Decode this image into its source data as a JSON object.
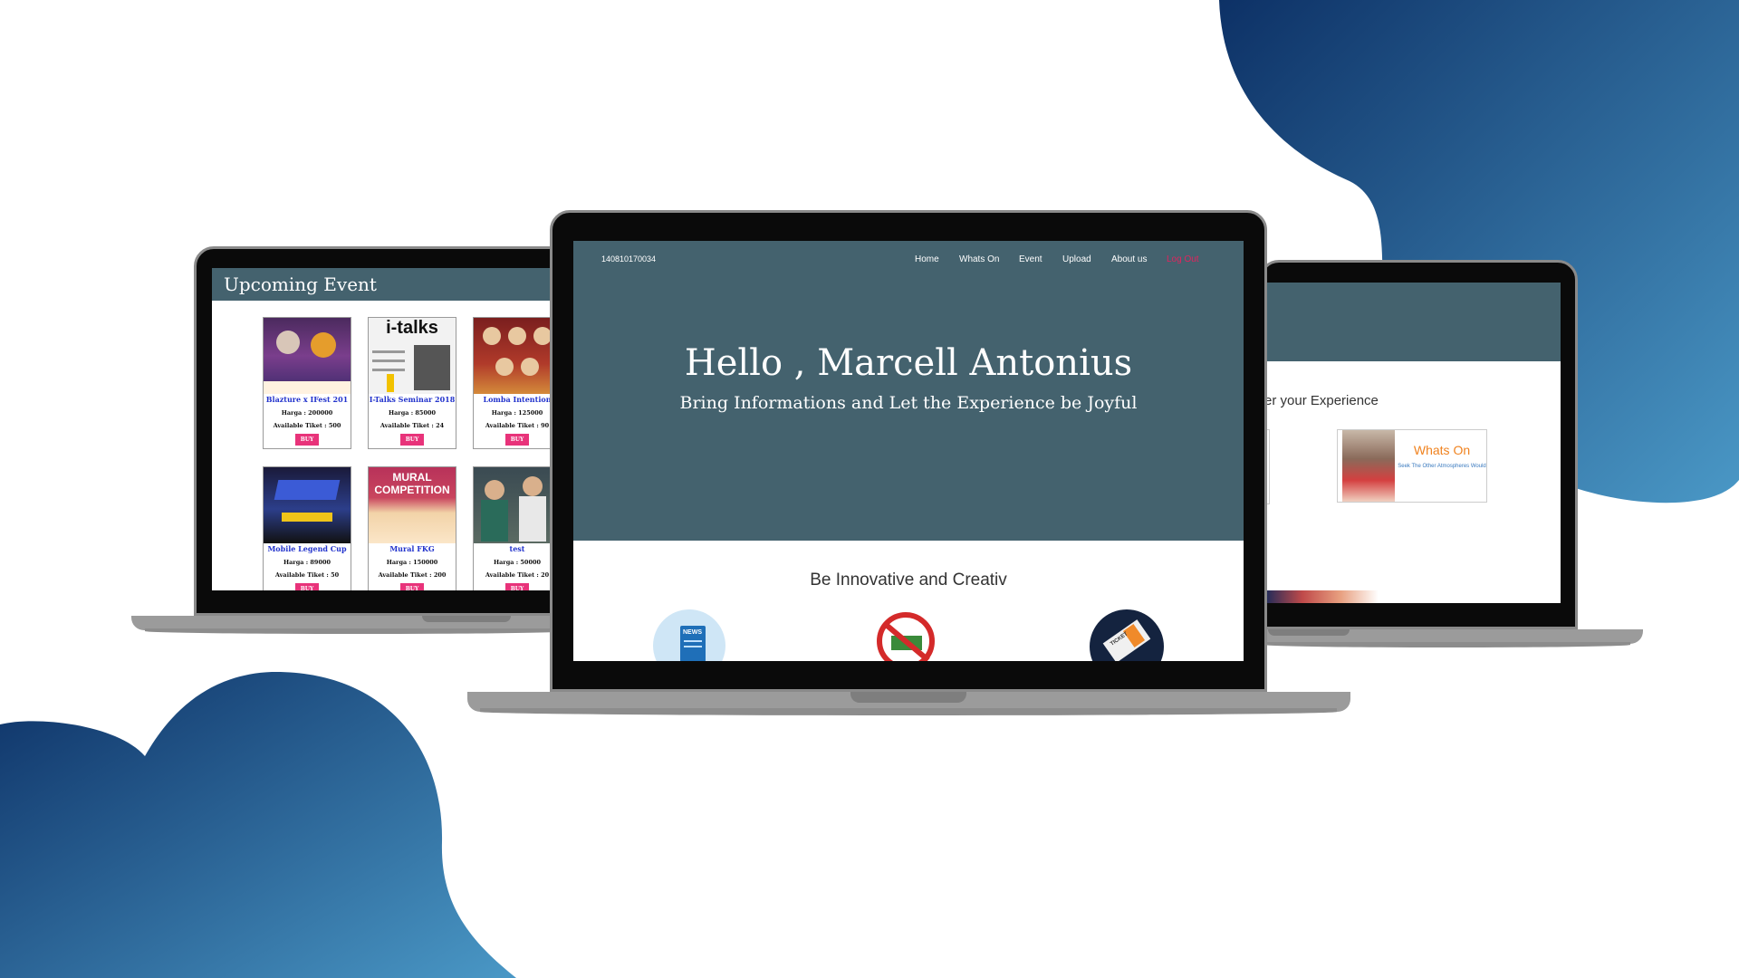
{
  "left_screen": {
    "header_title": "Upcoming Event",
    "events": [
      {
        "title": "Blazture x IFest 201",
        "price": "Harga : 200000",
        "available": "Available Tiket : 500",
        "buy": "BUY"
      },
      {
        "title": "I-Talks Seminar 2018",
        "price": "Harga : 85000",
        "available": "Available Tiket : 24",
        "buy": "BUY"
      },
      {
        "title": "Lomba Intention",
        "price": "Harga : 125000",
        "available": "Available Tiket : 90",
        "buy": "BUY"
      },
      {
        "title": "Mobile Legend Cup",
        "price": "Harga : 89000",
        "available": "Available Tiket : 50",
        "buy": "BUY"
      },
      {
        "title": "Mural FKG",
        "price": "Harga : 150000",
        "available": "Available Tiket : 200",
        "buy": "BUY"
      },
      {
        "title": "test",
        "price": "Harga : 50000",
        "available": "Available Tiket : 20",
        "buy": "BUY"
      }
    ],
    "poster_texts": {
      "italks": "i-talks",
      "mural": "MURAL COMPETITION"
    }
  },
  "center_screen": {
    "user_id": "140810170034",
    "nav": [
      "Home",
      "Whats On",
      "Event",
      "Upload",
      "About us",
      "Log Out"
    ],
    "hero_title": "Hello , Marcell Antonius",
    "hero_subtitle": "Bring Informations and Let the Experience be Joyful",
    "section_title": "Be Innovative and Creativ",
    "icons": {
      "news": "NEWS",
      "ticket": "TICKET"
    }
  },
  "right_screen": {
    "section_text": "er your Experience",
    "card_title": "Whats On",
    "card_desc": "Seek The Other Atmospheres Would"
  },
  "colors": {
    "header_bar": "#44626e",
    "blob_dark": "#0d3166",
    "blob_light": "#4a98c6",
    "buy_button": "#e8337a",
    "logout_link": "#e0245e",
    "whats_on_orange": "#f0821e"
  }
}
